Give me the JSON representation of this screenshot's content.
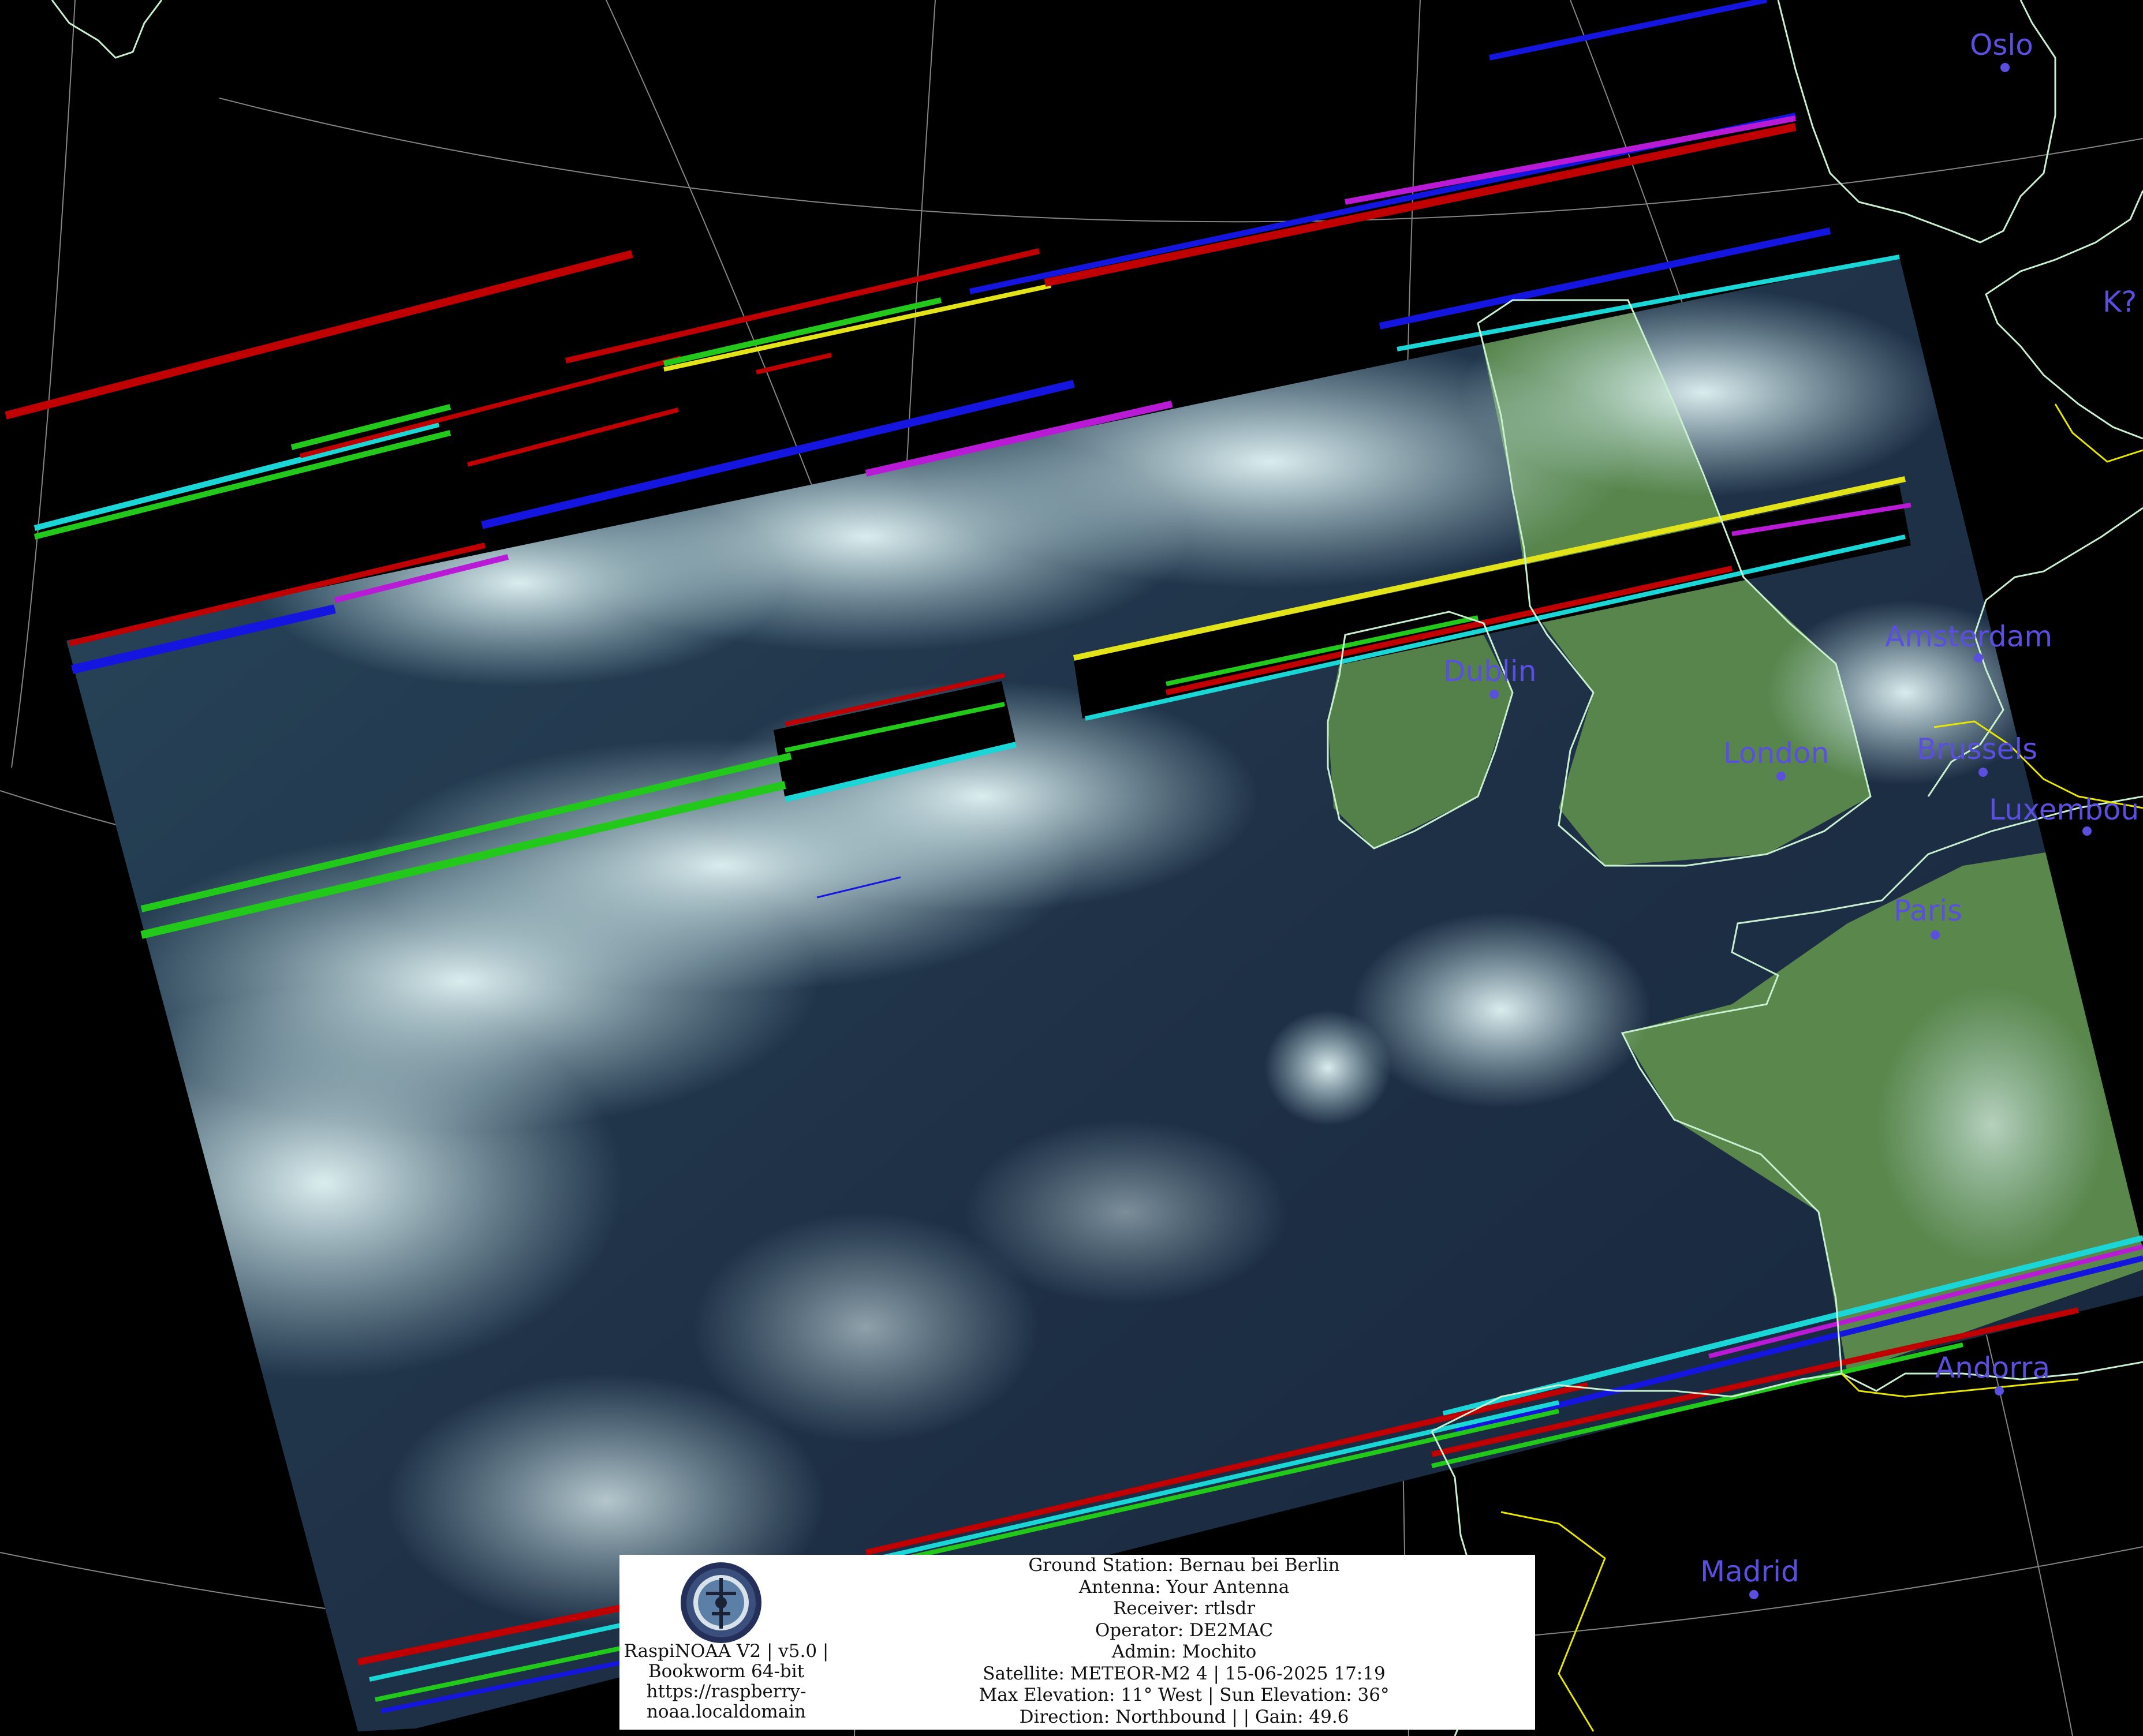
{
  "image": {
    "description_colors": {
      "background": "#000000",
      "coastline": "#c8f0d0",
      "border": "#e6e600",
      "graticule": "#cfcfcf",
      "city_label": "#5b4fe0",
      "cloud": "#cfe8ea",
      "ocean": "#1d3450",
      "land": "#4f7d45"
    }
  },
  "cities": [
    {
      "name": "Oslo"
    },
    {
      "name": "K?"
    },
    {
      "name": "Amsterdam"
    },
    {
      "name": "Dublin"
    },
    {
      "name": "London"
    },
    {
      "name": "Brussels"
    },
    {
      "name": "Luxembou"
    },
    {
      "name": "Paris"
    },
    {
      "name": "Andorra"
    },
    {
      "name": "Madrid"
    }
  ],
  "info_panel": {
    "software": {
      "line1": "RaspiNOAA V2 | v5.0 |",
      "line2": "Bookworm 64-bit",
      "line3": "https://raspberry-",
      "line4": "noaa.localdomain"
    },
    "station": {
      "ground_station": "Ground Station: Bernau bei Berlin",
      "antenna": "Antenna: Your Antenna",
      "receiver": "Receiver: rtlsdr",
      "operator": "Operator: DE2MAC",
      "admin": "Admin: Mochito",
      "satellite": "Satellite: METEOR-M2 4 | 15-06-2025 17:19",
      "elevation": "Max Elevation: 11° West | Sun Elevation: 36°",
      "direction": "Direction: Northbound | | Gain: 49.6"
    }
  }
}
